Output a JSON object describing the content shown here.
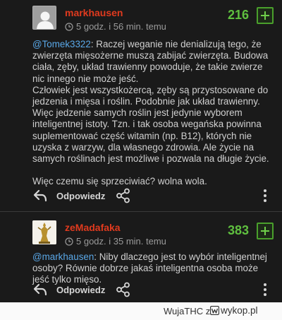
{
  "comments": [
    {
      "username": "markhausen",
      "time": "5 godz. i 56 min. temu",
      "votes": "216",
      "mention": "@Tomek3322",
      "lines": [
        ": Raczej weganie nie denializują tego, że",
        "zwierzęta mięsożerne muszą zabijać zwierzęta. Budowa",
        "ciała, zęby, układ trawienny powoduje, że takie zwierze",
        "nic innego nie może jeść.",
        "Człowiek jest wszystkożercą, zęby są przystosowane do",
        "jedzenia i mięsa i roślin. Podobnie jak układ trawienny.",
        "Więc jedzenie samych roślin jest jedynie wyborem",
        "inteligentnej istoty. Tzn. i tak osoba wegańska powinna",
        "suplementować część witamin (np. B12), których nie",
        "uzyska z warzyw, dla własnego zdrowia. Ale życie na",
        "samych roślinach jest możliwe i pozwala na długie życie.",
        "",
        "Więc czemu się sprzeciwiać? wolna wola."
      ],
      "reply_label": "Odpowiedz"
    },
    {
      "username": "zeMadafaka",
      "time": "5 godz. i 35 min. temu",
      "votes": "383",
      "mention": "@markhausen",
      "lines": [
        ": Niby dlaczego jest to wybór inteligentnej",
        "osoby? Równie dobrze jakaś inteligentna osoba może",
        "jeść tylko mięso."
      ],
      "reply_label": "Odpowiedz"
    }
  ],
  "footer": {
    "credit": "WujaTHC z",
    "site": "wykop.pl"
  },
  "colors": {
    "username": "#e03a1e",
    "votes": "#5fbf3f",
    "mention": "#5aa8e8",
    "background": "#1a1a1a"
  },
  "icons": [
    "user-avatar",
    "clock-icon",
    "plus-icon",
    "reply-icon",
    "share-icon",
    "more-icon",
    "wykop-icon"
  ]
}
